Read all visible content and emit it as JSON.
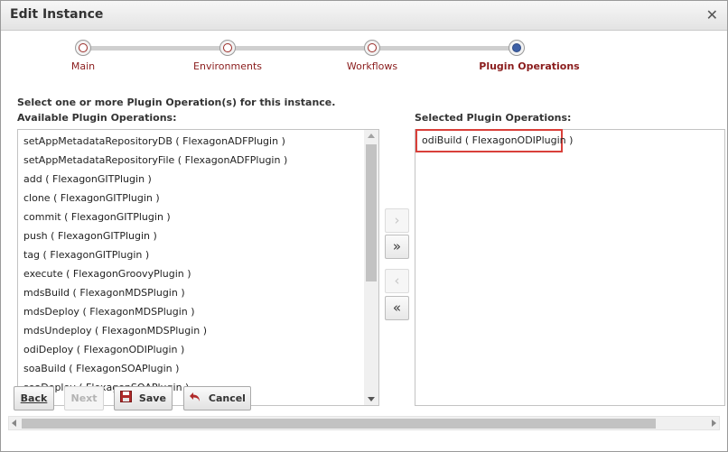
{
  "dialog": {
    "title": "Edit Instance",
    "close_icon": "close-icon"
  },
  "wizard": {
    "steps": [
      {
        "label": "Main",
        "active": false
      },
      {
        "label": "Environments",
        "active": false
      },
      {
        "label": "Workflows",
        "active": false
      },
      {
        "label": "Plugin Operations",
        "active": true
      }
    ]
  },
  "instruction": "Select one or more Plugin Operation(s) for this instance.",
  "available": {
    "header": "Available Plugin Operations:",
    "items": [
      "setAppMetadataRepositoryDB ( FlexagonADFPlugin )",
      "setAppMetadataRepositoryFile ( FlexagonADFPlugin )",
      "add ( FlexagonGITPlugin )",
      "clone ( FlexagonGITPlugin )",
      "commit ( FlexagonGITPlugin )",
      "push ( FlexagonGITPlugin )",
      "tag ( FlexagonGITPlugin )",
      "execute ( FlexagonGroovyPlugin )",
      "mdsBuild ( FlexagonMDSPlugin )",
      "mdsDeploy ( FlexagonMDSPlugin )",
      "mdsUndeploy ( FlexagonMDSPlugin )",
      "odiDeploy ( FlexagonODIPlugin )",
      "soaBuild ( FlexagonSOAPlugin )",
      "soaDeploy ( FlexagonSOAPlugin )"
    ]
  },
  "selected": {
    "header": "Selected Plugin Operations:",
    "items": [
      "odiBuild ( FlexagonODIPlugin )"
    ]
  },
  "move_buttons": {
    "move_one": "›",
    "move_all": "»",
    "remove_one": "‹",
    "remove_all": "«"
  },
  "footer": {
    "back": "Back",
    "next": "Next",
    "save": "Save",
    "cancel": "Cancel"
  },
  "colors": {
    "step_label": "#8a1c1c",
    "highlight_border": "#d9403a",
    "active_step": "#3d5fa5"
  }
}
